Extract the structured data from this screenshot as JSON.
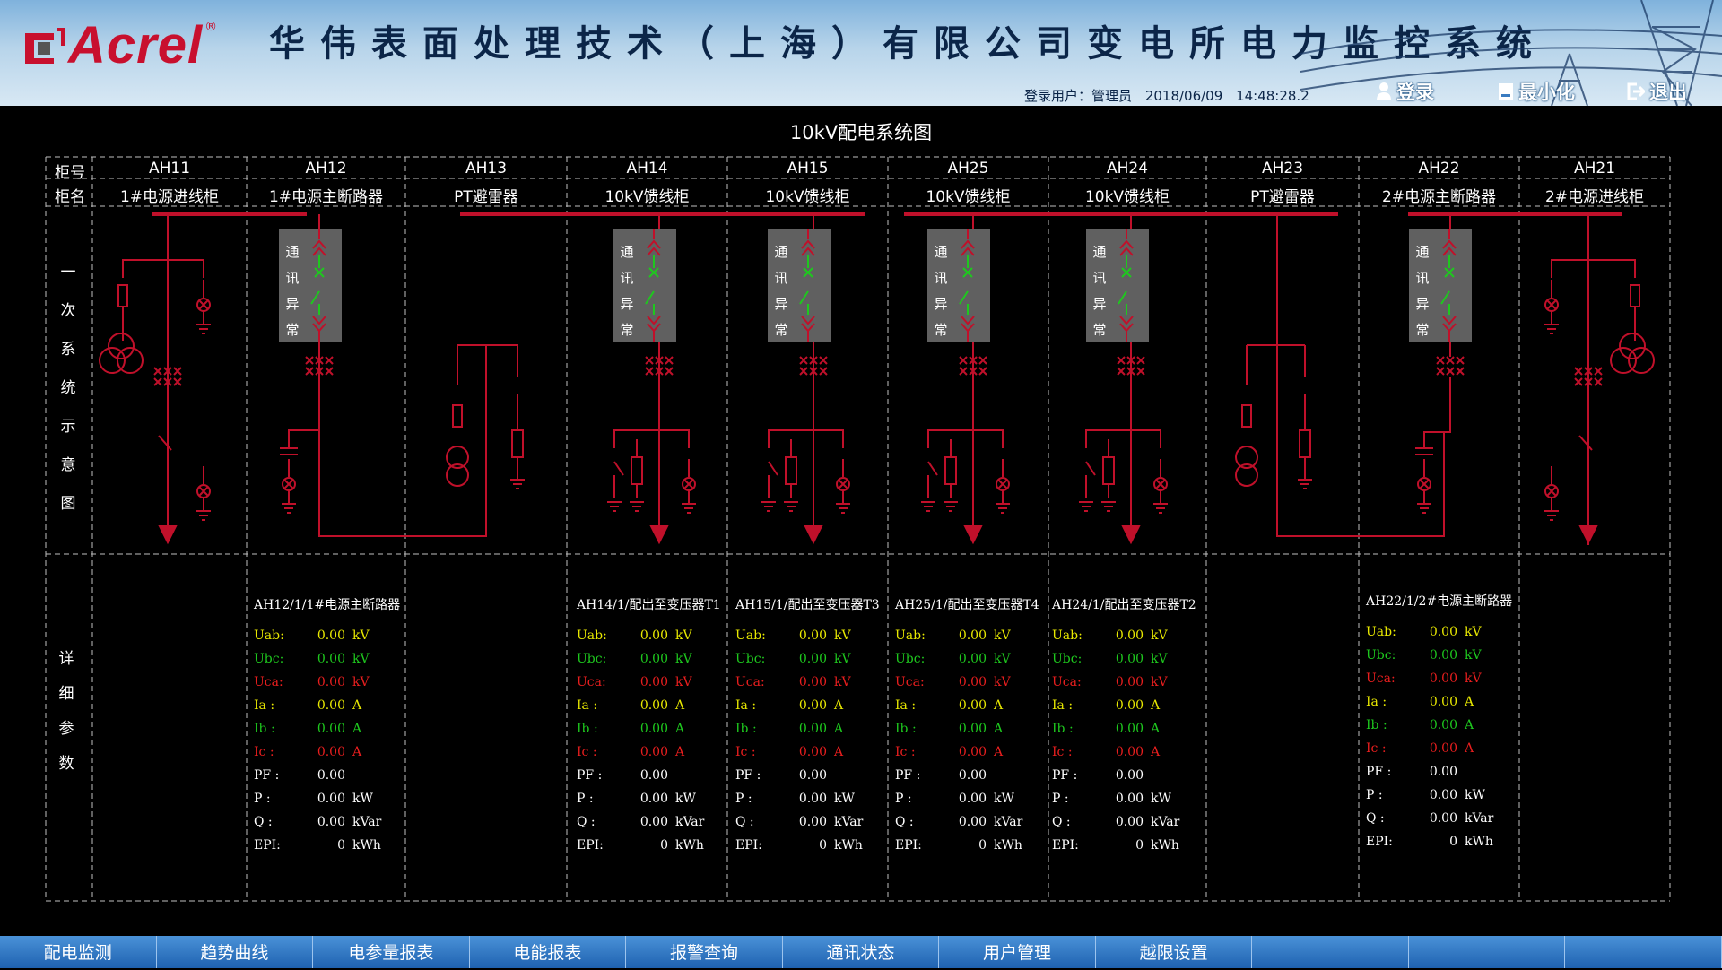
{
  "header": {
    "brand": "Acrel",
    "brand_reg": "®",
    "app_title": "华伟表面处理技术（上海）有限公司变电所电力监控系统",
    "login_user_label": "登录用户：",
    "login_user": "管理员",
    "date": "2018/06/09",
    "time": "14:48:28.2",
    "buttons": {
      "login": "登录",
      "minimize": "最小化",
      "exit": "退出"
    },
    "icons": {
      "login": "user-icon",
      "minimize": "minimize-icon",
      "exit": "exit-icon"
    }
  },
  "diagram": {
    "title": "10kV配电系统图",
    "row_labels": {
      "cabinet_no": "柜号",
      "cabinet_name": "柜名",
      "primary": "一次系统示意图",
      "details": "详细参数"
    },
    "cabinets": [
      {
        "no": "AH11",
        "name": "1#电源进线柜"
      },
      {
        "no": "AH12",
        "name": "1#电源主断路器"
      },
      {
        "no": "AH13",
        "name": "PT避雷器"
      },
      {
        "no": "AH14",
        "name": "10kV馈线柜"
      },
      {
        "no": "AH15",
        "name": "10kV馈线柜"
      },
      {
        "no": "AH25",
        "name": "10kV馈线柜"
      },
      {
        "no": "AH24",
        "name": "10kV馈线柜"
      },
      {
        "no": "AH23",
        "name": "PT避雷器"
      },
      {
        "no": "AH22",
        "name": "2#电源主断路器"
      },
      {
        "no": "AH21",
        "name": "2#电源进线柜"
      }
    ],
    "comm_status": "通讯异常"
  },
  "panels": [
    {
      "title": "AH12/1/1#电源主断路器"
    },
    {
      "title": "AH14/1/配出至变压器T1"
    },
    {
      "title": "AH15/1/配出至变压器T3"
    },
    {
      "title": "AH25/1/配出至变压器T4"
    },
    {
      "title": "AH24/1/配出至变压器T2"
    },
    {
      "title": "AH22/1/2#电源主断路器"
    }
  ],
  "param_rows": [
    {
      "name": "Uab:",
      "value": "0.00",
      "unit": "kV",
      "color": "#e8e800"
    },
    {
      "name": "Ubc:",
      "value": "0.00",
      "unit": "kV",
      "color": "#1ec81e"
    },
    {
      "name": "Uca:",
      "value": "0.00",
      "unit": "kV",
      "color": "#e81e1e"
    },
    {
      "name": "Ia :",
      "value": "0.00",
      "unit": "A",
      "color": "#e8e800"
    },
    {
      "name": "Ib :",
      "value": "0.00",
      "unit": "A",
      "color": "#1ec81e"
    },
    {
      "name": "Ic :",
      "value": "0.00",
      "unit": "A",
      "color": "#e81e1e"
    },
    {
      "name": "PF :",
      "value": "0.00",
      "unit": "",
      "color": "#ffffff"
    },
    {
      "name": "P  :",
      "value": "0.00",
      "unit": "kW",
      "color": "#ffffff"
    },
    {
      "name": "Q  :",
      "value": "0.00",
      "unit": "kVar",
      "color": "#ffffff"
    },
    {
      "name": "EPI:",
      "value": "0",
      "unit": "kWh",
      "color": "#ffffff"
    }
  ],
  "nav": [
    "配电监测",
    "趋势曲线",
    "电参量报表",
    "电能报表",
    "报警查询",
    "通讯状态",
    "用户管理",
    "越限设置",
    "",
    "",
    ""
  ],
  "colors": {
    "bus": "#c0102a",
    "header_bg": "#b7d4ea",
    "nav_bg": "#2f78c6",
    "grid": "#bfbfbf",
    "comm_box": "#606060"
  }
}
